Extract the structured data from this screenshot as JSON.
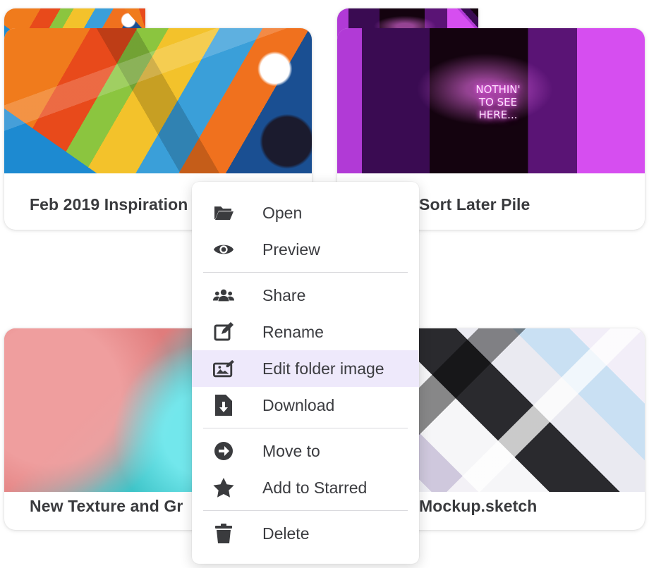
{
  "folders": [
    {
      "id": "bear",
      "label": "Feb 2019 Inspiration"
    },
    {
      "id": "neon",
      "label": "Sort Later Pile",
      "neon_text": "NOTHIN' TO SEE HERE..."
    },
    {
      "id": "sequin",
      "label": "New Texture and Gr"
    },
    {
      "id": "mock",
      "label": "Mockup.sketch"
    }
  ],
  "menu": {
    "items": [
      {
        "label": "Open",
        "icon": "folder-open-icon"
      },
      {
        "label": "Preview",
        "icon": "eye-icon"
      },
      {
        "label": "Share",
        "icon": "users-icon"
      },
      {
        "label": "Rename",
        "icon": "edit-icon"
      },
      {
        "label": "Edit folder image",
        "icon": "image-edit-icon",
        "highlighted": true
      },
      {
        "label": "Download",
        "icon": "file-download-icon"
      },
      {
        "label": "Move to",
        "icon": "arrow-circle-right-icon"
      },
      {
        "label": "Add to Starred",
        "icon": "star-icon"
      },
      {
        "label": "Delete",
        "icon": "trash-icon"
      }
    ]
  },
  "colors": {
    "highlight": "#eee9fb",
    "text": "#3b3c40"
  }
}
